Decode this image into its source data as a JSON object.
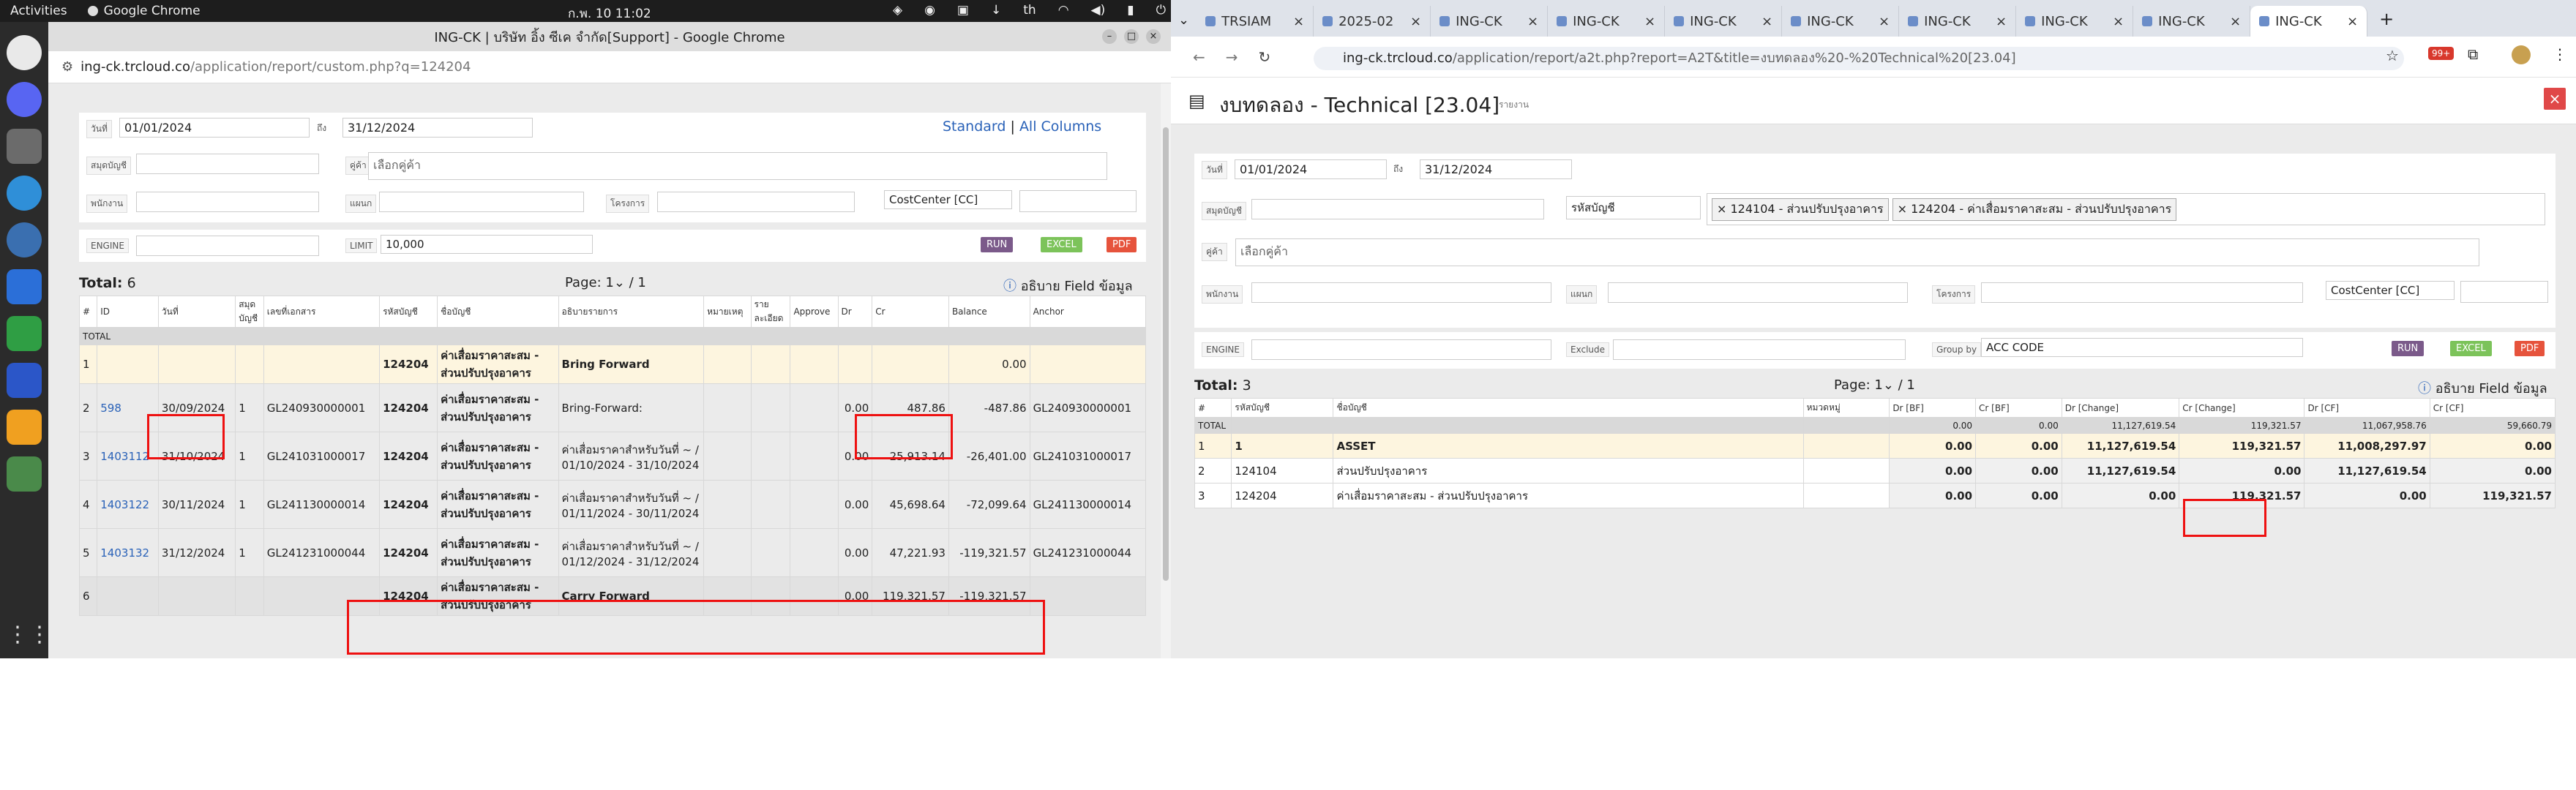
{
  "topbar": {
    "activities": "Activities",
    "app": "Google Chrome",
    "clock": "ก.พ. 10  11:02",
    "lang": "th"
  },
  "left": {
    "title": "ING-CK | บริษัท อิ้ง ซีเค จำกัด[Support] - Google Chrome",
    "url_host": "ing-ck.trcloud.co",
    "url_path": "/application/report/custom.php?q=124204",
    "filters": {
      "date_label": "วันที่",
      "date_from": "01/01/2024",
      "to_label": "ถึง",
      "date_to": "31/12/2024",
      "standard": "Standard",
      "sep": "|",
      "all_columns": "All Columns",
      "book_label": "สมุดบัญชี",
      "partner_label": "คู่ค้า",
      "partner_placeholder": "เลือกคู่ค้า",
      "staff_label": "พนักงาน",
      "dept_label": "แผนก",
      "project_label": "โครงการ",
      "costcenter": "CostCenter [CC]",
      "engine_label": "ENGINE",
      "limit_label": "LIMIT",
      "limit_value": "10,000",
      "run": "RUN",
      "excel": "EXCEL",
      "pdf": "PDF"
    },
    "total_label": "Total:",
    "total_value": "6",
    "page_label": "Page:",
    "page_value": "1",
    "page_of": "/ 1",
    "field_desc": "อธิบาย Field ข้อมูล",
    "columns": [
      "#",
      "ID",
      "วันที่",
      "สมุดบัญชี",
      "เลขที่เอกสาร",
      "รหัสบัญชี",
      "ชื่อบัญชี",
      "อธิบายรายการ",
      "หมายเหตุ",
      "ราย ละเอียด",
      "Approve",
      "Dr",
      "Cr",
      "Balance",
      "Anchor"
    ],
    "total_row": "TOTAL",
    "rows": [
      {
        "n": "1",
        "id": "",
        "date": "",
        "book": "",
        "doc": "",
        "code": "124204",
        "name": "ค่าเสื่อมราคาสะสม - ส่วนปรับปรุงอาคาร",
        "desc": "Bring Forward",
        "dr": "",
        "cr": "",
        "bal": "0.00",
        "anchor": ""
      },
      {
        "n": "2",
        "id": "598",
        "date": "30/09/2024",
        "book": "1",
        "doc": "GL240930000001",
        "code": "124204",
        "name": "ค่าเสื่อมราคาสะสม - ส่วนปรับปรุงอาคาร",
        "desc": "Bring-Forward:",
        "dr": "0.00",
        "cr": "487.86",
        "bal": "-487.86",
        "anchor": "GL240930000001"
      },
      {
        "n": "3",
        "id": "1403112",
        "date": "31/10/2024",
        "book": "1",
        "doc": "GL241031000017",
        "code": "124204",
        "name": "ค่าเสื่อมราคาสะสม - ส่วนปรับปรุงอาคาร",
        "desc": "ค่าเสื่อมราคาสำหรับวันที่ ~ / 01/10/2024 - 31/10/2024",
        "dr": "0.00",
        "cr": "25,913.14",
        "bal": "-26,401.00",
        "anchor": "GL241031000017"
      },
      {
        "n": "4",
        "id": "1403122",
        "date": "30/11/2024",
        "book": "1",
        "doc": "GL241130000014",
        "code": "124204",
        "name": "ค่าเสื่อมราคาสะสม - ส่วนปรับปรุงอาคาร",
        "desc": "ค่าเสื่อมราคาสำหรับวันที่ ~ / 01/11/2024 - 30/11/2024",
        "dr": "0.00",
        "cr": "45,698.64",
        "bal": "-72,099.64",
        "anchor": "GL241130000014"
      },
      {
        "n": "5",
        "id": "1403132",
        "date": "31/12/2024",
        "book": "1",
        "doc": "GL241231000044",
        "code": "124204",
        "name": "ค่าเสื่อมราคาสะสม - ส่วนปรับปรุงอาคาร",
        "desc": "ค่าเสื่อมราคาสำหรับวันที่ ~ / 01/12/2024 - 31/12/2024",
        "dr": "0.00",
        "cr": "47,221.93",
        "bal": "-119,321.57",
        "anchor": "GL241231000044"
      },
      {
        "n": "6",
        "id": "",
        "date": "",
        "book": "",
        "doc": "",
        "code": "124204",
        "name": "ค่าเสื่อมราคาสะสม - ส่วนปรับปรุงอาคาร",
        "desc": "Carry Forward",
        "dr": "0.00",
        "cr": "119,321.57",
        "bal": "-119,321.57",
        "anchor": ""
      }
    ]
  },
  "right": {
    "tabs": [
      "TRSIAM",
      "2025-02",
      "ING-CK",
      "ING-CK",
      "ING-CK",
      "ING-CK",
      "ING-CK",
      "ING-CK",
      "ING-CK",
      "ING-CK"
    ],
    "ext_badge": "99+",
    "url_host": "ing-ck.trcloud.co",
    "url_path": "/application/report/a2t.php?report=A2T&title=งบทดลอง%20-%20Technical%20[23.04]",
    "title": "งบทดลอง - Technical [23.04]",
    "subtitle": "รายงาน",
    "filters": {
      "date_label": "วันที่",
      "date_from": "01/01/2024",
      "to_label": "ถึง",
      "date_to": "31/12/2024",
      "book_label": "สมุดบัญชี",
      "acc_select": "รหัสบัญชี",
      "tag1": "124104 - ส่วนปรับปรุงอาคาร",
      "tag2": "124204 - ค่าเสื่อมราคาสะสม - ส่วนปรับปรุงอาคาร",
      "partner_label": "คู่ค้า",
      "partner_placeholder": "เลือกคู่ค้า",
      "staff_label": "พนักงาน",
      "dept_label": "แผนก",
      "project_label": "โครงการ",
      "costcenter": "CostCenter [CC]",
      "engine_label": "ENGINE",
      "exclude_label": "Exclude",
      "groupby_label": "Group by",
      "groupby_value": "ACC CODE",
      "run": "RUN",
      "excel": "EXCEL",
      "pdf": "PDF"
    },
    "total_label": "Total:",
    "total_value": "3",
    "page_label": "Page:",
    "page_value": "1",
    "page_of": "/ 1",
    "field_desc": "อธิบาย Field ข้อมูล",
    "columns": [
      "#",
      "รหัสบัญชี",
      "ชื่อบัญชี",
      "หมวดหมู่",
      "Dr [BF]",
      "Cr [BF]",
      "Dr [Change]",
      "Cr [Change]",
      "Dr [CF]",
      "Cr [CF]"
    ],
    "total_row": {
      "label": "TOTAL",
      "dr_bf": "0.00",
      "cr_bf": "0.00",
      "dr_ch": "11,127,619.54",
      "cr_ch": "119,321.57",
      "dr_cf": "11,067,958.76",
      "cr_cf": "59,660.79"
    },
    "rows": [
      {
        "n": "1",
        "code": "1",
        "name": "ASSET",
        "cat": "",
        "dr_bf": "0.00",
        "cr_bf": "0.00",
        "dr_ch": "11,127,619.54",
        "cr_ch": "119,321.57",
        "dr_cf": "11,008,297.97",
        "cr_cf": "0.00"
      },
      {
        "n": "2",
        "code": "124104",
        "name": "ส่วนปรับปรุงอาคาร",
        "cat": "",
        "dr_bf": "0.00",
        "cr_bf": "0.00",
        "dr_ch": "11,127,619.54",
        "cr_ch": "0.00",
        "dr_cf": "11,127,619.54",
        "cr_cf": "0.00"
      },
      {
        "n": "3",
        "code": "124204",
        "name": "ค่าเสื่อมราคาสะสม - ส่วนปรับปรุงอาคาร",
        "cat": "",
        "dr_bf": "0.00",
        "cr_bf": "0.00",
        "dr_ch": "0.00",
        "cr_ch": "119,321.57",
        "dr_cf": "0.00",
        "cr_cf": "119,321.57"
      }
    ]
  },
  "colors": {
    "run": "#7b5a8a",
    "excel": "#7cc35a",
    "pdf": "#e6533c",
    "link": "#2a62b8",
    "highlight": "#e11111"
  }
}
